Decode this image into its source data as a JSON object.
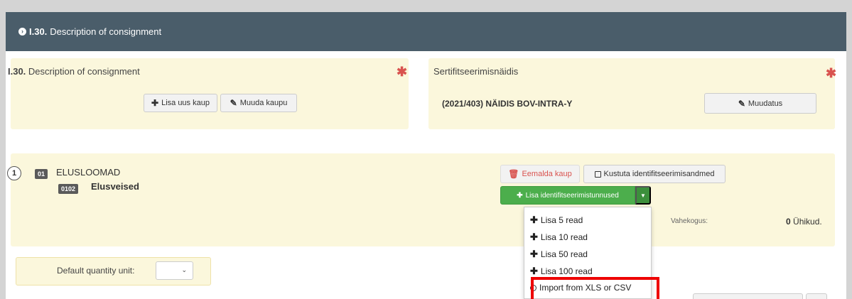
{
  "header": {
    "code": "I.30.",
    "title": "Description of consignment"
  },
  "left_panel": {
    "code": "I.30.",
    "title": "Description of consignment",
    "add_label": "Lisa uus kaup",
    "edit_label": "Muuda kaupu"
  },
  "right_panel": {
    "title": "Sertifitseerimisnäidis",
    "certificate": "(2021/403) NÄIDIS BOV-INTRA-Y",
    "edit_label": "Muudatus"
  },
  "item": {
    "index": "1",
    "category_code": "01",
    "category_name": "ELUSLOOMAD",
    "subcategory_code": "0102",
    "subcategory_name": "Elusveised",
    "remove_label": "Eemalda kaup",
    "clear_label": "Kustuta identifitseerimisandmed",
    "add_id_label": "Lisa identifitseerimistunnused",
    "remainder_label": "Vahekogus:",
    "remainder_value": "0",
    "remainder_unit": "Ühikud."
  },
  "dropdown": {
    "items": [
      "Lisa 5 read",
      "Lisa 10 read",
      "Lisa 50 read",
      "Lisa 100 read",
      "Import from XLS or CSV"
    ]
  },
  "default_quantity": {
    "label": "Default quantity unit:",
    "value": ""
  },
  "colors": {
    "header_bg": "#4a5d6a",
    "panel_bg": "#fbf7dc",
    "green": "#4cae4c",
    "required": "#d9534f",
    "highlight": "#ee0000"
  }
}
